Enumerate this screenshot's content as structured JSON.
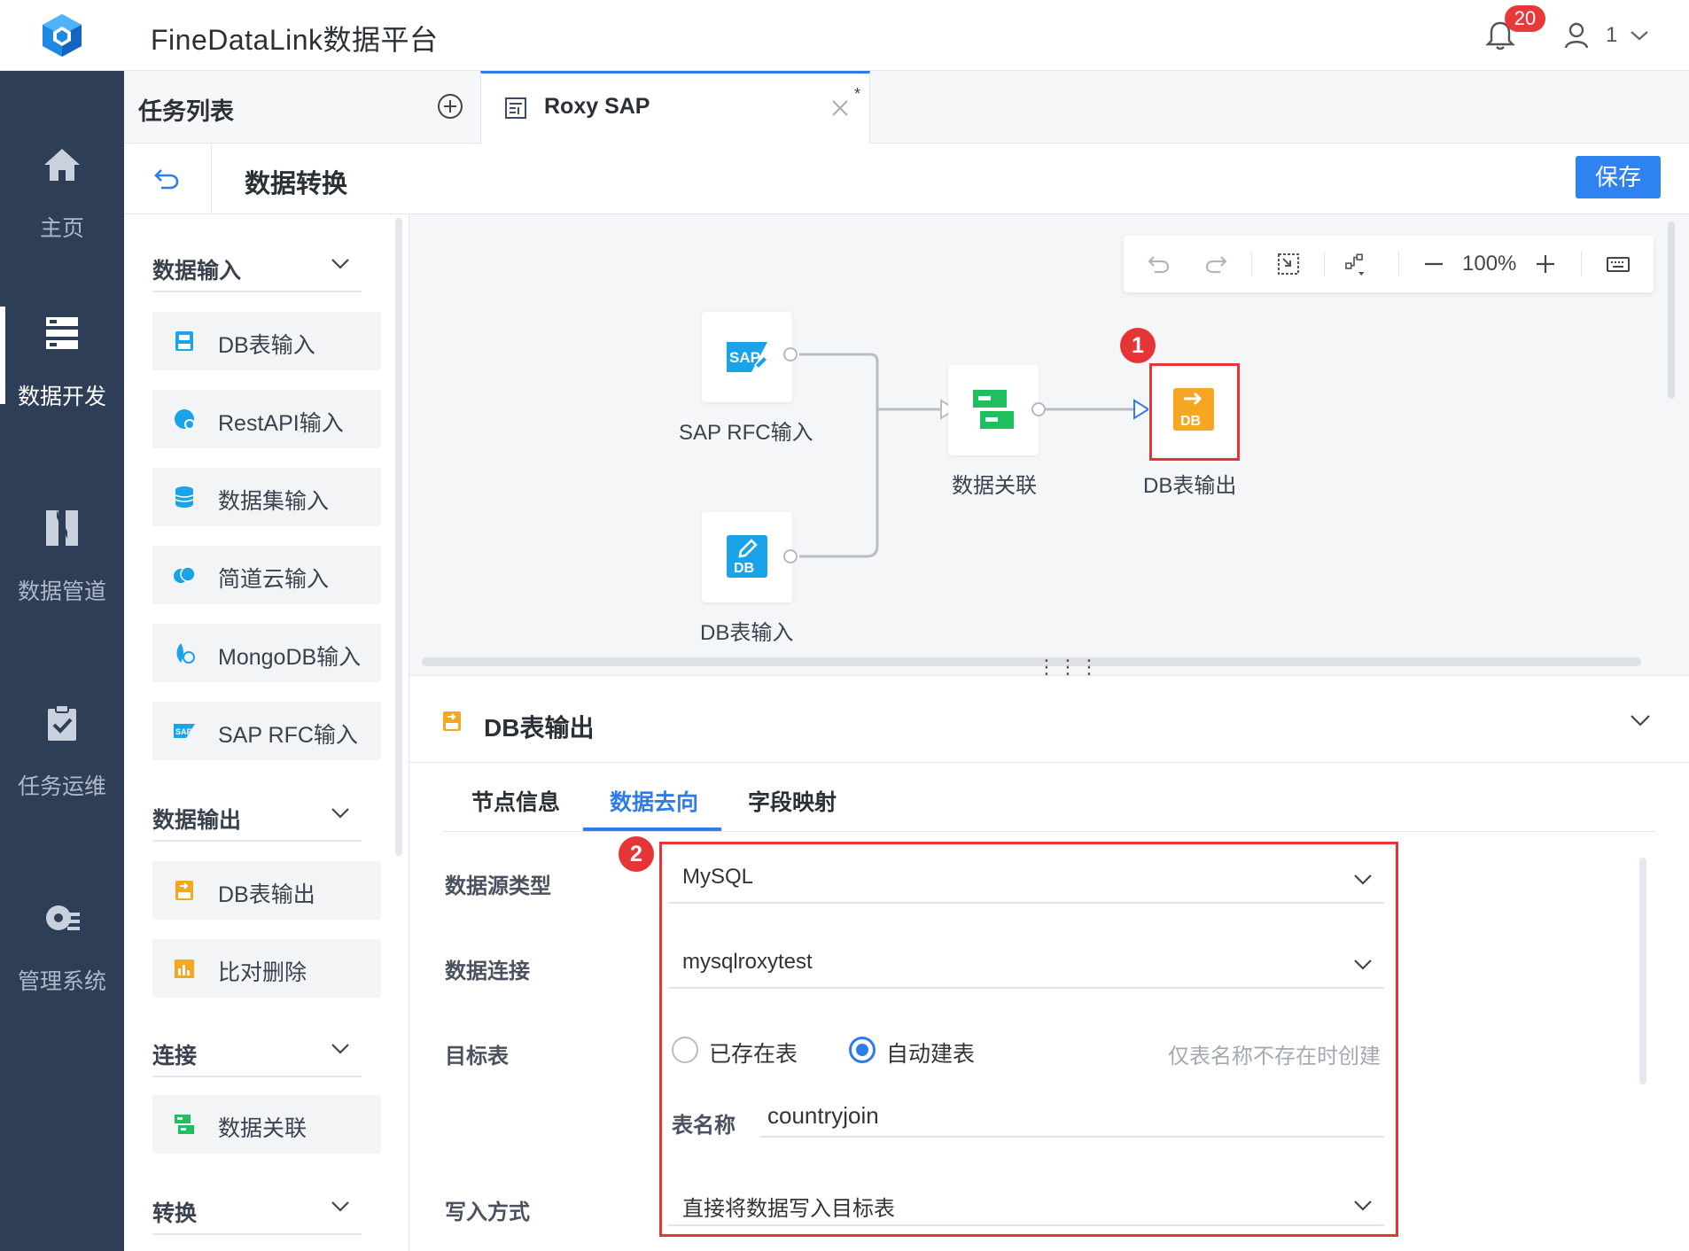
{
  "header": {
    "app_title": "FineDataLink数据平台",
    "notification_count": "20",
    "user_name": "1"
  },
  "left_nav": [
    {
      "label": "主页",
      "icon": "home-icon",
      "active": false
    },
    {
      "label": "数据开发",
      "icon": "data-dev-icon",
      "active": true
    },
    {
      "label": "数据管道",
      "icon": "pipeline-icon",
      "active": false
    },
    {
      "label": "任务运维",
      "icon": "task-ops-icon",
      "active": false
    },
    {
      "label": "管理系统",
      "icon": "admin-gear-icon",
      "active": false
    }
  ],
  "tabs": {
    "task_list_title": "任务列表",
    "open_tab_label": "Roxy SAP",
    "dirty_marker": "*"
  },
  "subheader": {
    "title": "数据转换",
    "save_label": "保存"
  },
  "palette": {
    "sections": [
      {
        "title": "数据输入",
        "items": [
          {
            "label": "DB表输入",
            "icon": "db-input-icon"
          },
          {
            "label": "RestAPI输入",
            "icon": "restapi-icon"
          },
          {
            "label": "数据集输入",
            "icon": "dataset-icon"
          },
          {
            "label": "简道云输入",
            "icon": "jiandaoyun-icon"
          },
          {
            "label": "MongoDB输入",
            "icon": "mongodb-icon"
          },
          {
            "label": "SAP RFC输入",
            "icon": "sap-icon"
          }
        ]
      },
      {
        "title": "数据输出",
        "items": [
          {
            "label": "DB表输出",
            "icon": "db-output-icon"
          },
          {
            "label": "比对删除",
            "icon": "compare-delete-icon"
          }
        ]
      },
      {
        "title": "连接",
        "items": [
          {
            "label": "数据关联",
            "icon": "data-join-icon"
          }
        ]
      },
      {
        "title": "转换",
        "items": []
      }
    ]
  },
  "canvas": {
    "zoom": "100%",
    "nodes": [
      {
        "id": "sap",
        "label": "SAP RFC输入"
      },
      {
        "id": "dbin",
        "label": "DB表输入"
      },
      {
        "id": "join",
        "label": "数据关联"
      },
      {
        "id": "dbout",
        "label": "DB表输出"
      }
    ],
    "badge_1": "1",
    "node_icon_text": {
      "sap": "SAP",
      "db": "DB"
    }
  },
  "panel": {
    "title": "DB表输出",
    "tabs": [
      "节点信息",
      "数据去向",
      "字段映射"
    ],
    "active_tab": "数据去向",
    "badge_2": "2",
    "form": {
      "datasource_type_label": "数据源类型",
      "datasource_type_value": "MySQL",
      "connection_label": "数据连接",
      "connection_value": "mysqlroxytest",
      "target_table_label": "目标表",
      "radio_existing": "已存在表",
      "radio_auto": "自动建表",
      "selected_radio": "自动建表",
      "hint": "仅表名称不存在时创建",
      "table_name_label": "表名称",
      "table_name_value": "countryjoin",
      "write_mode_label": "写入方式",
      "write_mode_value": "直接将数据写入目标表"
    }
  },
  "colors": {
    "accent": "#2f7bea",
    "nav_bg": "#2f3e57",
    "highlight_red": "#e53537",
    "sap_blue": "#1aa3e8",
    "join_green": "#1fbf5f",
    "output_orange": "#f5a623"
  }
}
